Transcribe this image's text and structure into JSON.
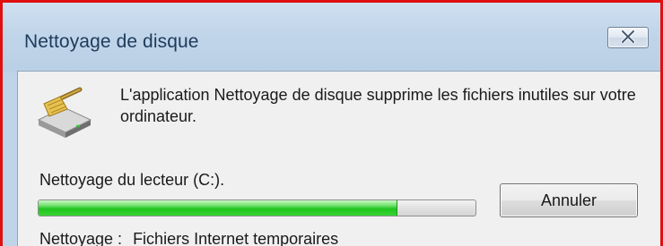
{
  "window": {
    "title": "Nettoyage de disque",
    "close_icon": "close-icon"
  },
  "dialog": {
    "description": "L'application Nettoyage de disque supprime les fichiers inutiles sur votre ordinateur.",
    "icon": "disk-cleanup-icon",
    "drive_label": "Nettoyage du lecteur  (C:).",
    "progress_fraction": 0.82,
    "cancel_label": "Annuler",
    "status_label": "Nettoyage :",
    "status_value": "Fichiers Internet temporaires"
  },
  "colors": {
    "frame_border": "#e01010",
    "title_text": "#1e3b5c",
    "progress_green": "#21c41f"
  }
}
